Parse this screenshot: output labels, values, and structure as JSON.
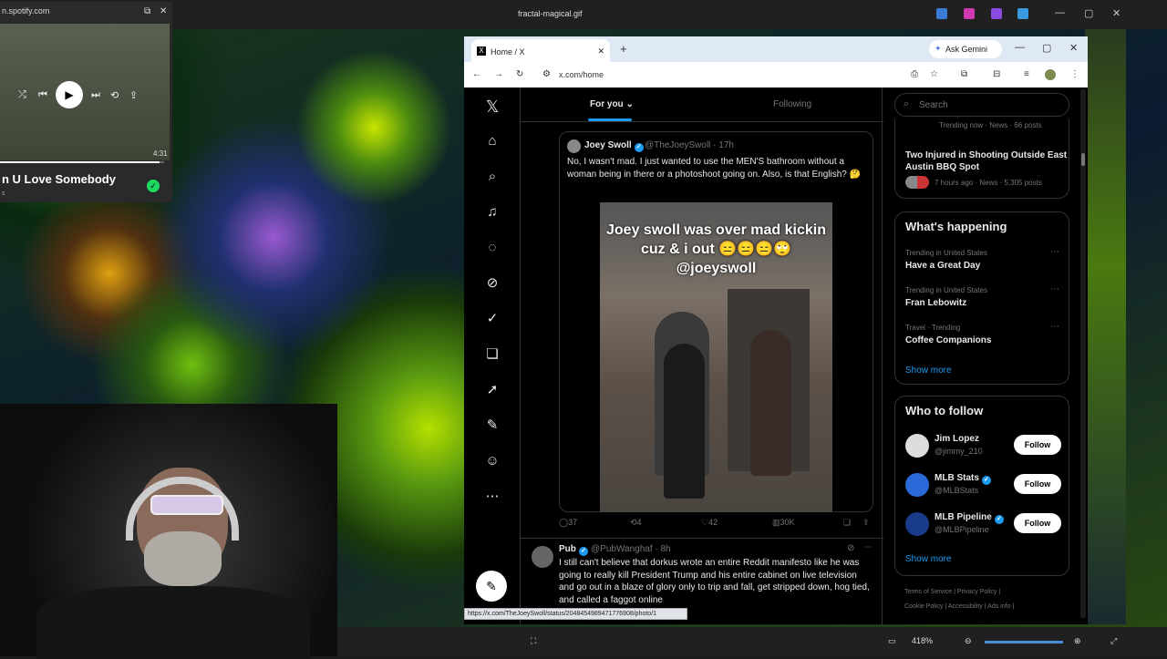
{
  "viewer": {
    "title": "fractal-magical.gif",
    "zoom": "418%"
  },
  "spotify": {
    "url": "n.spotify.com",
    "time": "4:31",
    "song": "n U Love Somebody",
    "sub": "s",
    "progress": 0.97
  },
  "browser": {
    "tab_title": "Home / X",
    "ask_gemini": "Ask Gemini",
    "url": "x.com/home",
    "status_url": "https://x.com/TheJoeySwoll/status/2048454989471776908/photo/1"
  },
  "feed": {
    "tab_for_you": "For you",
    "tab_following": "Following",
    "tweet1": {
      "name": "Joey Swoll",
      "handle": "@TheJoeySwoll · 17h",
      "text": "No, I wasn't mad. I just wanted to use the MEN'S bathroom without a woman being in there or a photoshoot going on. Also, is that English? 🤔",
      "media_caption": "Joey swoll was over mad kickin cuz & i out 😑😑😑🙄 @joeyswoll",
      "replies": "37",
      "reposts": "4",
      "likes": "42",
      "views": "30K"
    },
    "tweet2": {
      "name": "Pub",
      "handle": "@PubWanghaf · 8h",
      "text": "I still can't believe that dorkus wrote an entire Reddit manifesto like he was going to really kill President Trump and his entire cabinet on live television and go out in a blaze of glory only to trip and fall, get stripped down, hog tied, and called a faggot online"
    }
  },
  "sidebar": {
    "search_placeholder": "Search",
    "trend_top_meta": "Trending now · News · 66 posts",
    "trend_top_title": "Two Injured in Shooting Outside East Austin BBQ Spot",
    "trend_top_sub": "7 hours ago · News · 5,305 posts",
    "happening_title": "What's happening",
    "trends": [
      {
        "meta": "Trending in United States",
        "title": "Have a Great Day"
      },
      {
        "meta": "Trending in United States",
        "title": "Fran Lebowitz"
      },
      {
        "meta": "Travel · Trending",
        "title": "Coffee Companions"
      }
    ],
    "show_more": "Show more",
    "wtf_title": "Who to follow",
    "follow_label": "Follow",
    "wtf": [
      {
        "name": "Jim Lopez",
        "handle": "@jimmy_210"
      },
      {
        "name": "MLB Stats",
        "handle": "@MLBStats"
      },
      {
        "name": "MLB Pipeline",
        "handle": "@MLBPipeline"
      }
    ],
    "footer1": "Terms of Service  |  Privacy Policy  |",
    "footer2": "Cookie Policy  |  Accessibility  |  Ads info  |"
  }
}
